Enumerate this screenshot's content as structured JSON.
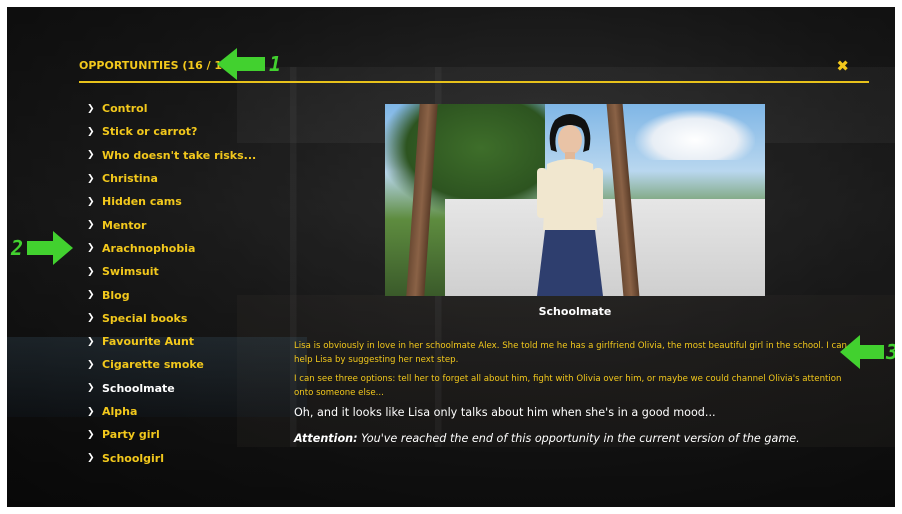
{
  "header": {
    "title": "OPPORTUNITIES (16 / 16)",
    "close_icon": "close-x-icon"
  },
  "annotations": [
    {
      "number": "1",
      "icon": "green-arrow-left"
    },
    {
      "number": "2",
      "icon": "green-arrow-right"
    },
    {
      "number": "3",
      "icon": "green-arrow-left"
    }
  ],
  "sidebar": {
    "items": [
      {
        "label": "Control"
      },
      {
        "label": "Stick or carrot?"
      },
      {
        "label": "Who doesn't take risks..."
      },
      {
        "label": "Christina"
      },
      {
        "label": "Hidden cams"
      },
      {
        "label": "Mentor"
      },
      {
        "label": "Arachnophobia"
      },
      {
        "label": "Swimsuit"
      },
      {
        "label": "Blog"
      },
      {
        "label": "Special books"
      },
      {
        "label": "Favourite Aunt"
      },
      {
        "label": "Cigarette smoke"
      },
      {
        "label": "Schoolmate"
      },
      {
        "label": "Alpha"
      },
      {
        "label": "Party girl"
      },
      {
        "label": "Schoolgirl"
      }
    ],
    "active_label": "Schoolmate"
  },
  "detail": {
    "caption": "Schoolmate",
    "para1": "Lisa is obviously in love in her schoolmate Alex. She told me he has a girlfriend Olivia, the most beautiful girl in the school. I can help Lisa by suggesting her next step.",
    "para2": "I can see three options: tell her to forget all about him, fight with Olivia over him, or maybe we could channel Olivia's attention onto someone else...",
    "para3": "Oh, and it looks like Lisa only talks about him when she's in a good mood...",
    "attention_label": "Attention:",
    "attention_text": "You've reached the end of this opportunity in the current version of the game."
  },
  "colors": {
    "accent": "#f2c81c",
    "annotation_green": "#42d12f",
    "active_text": "#ffffff"
  }
}
